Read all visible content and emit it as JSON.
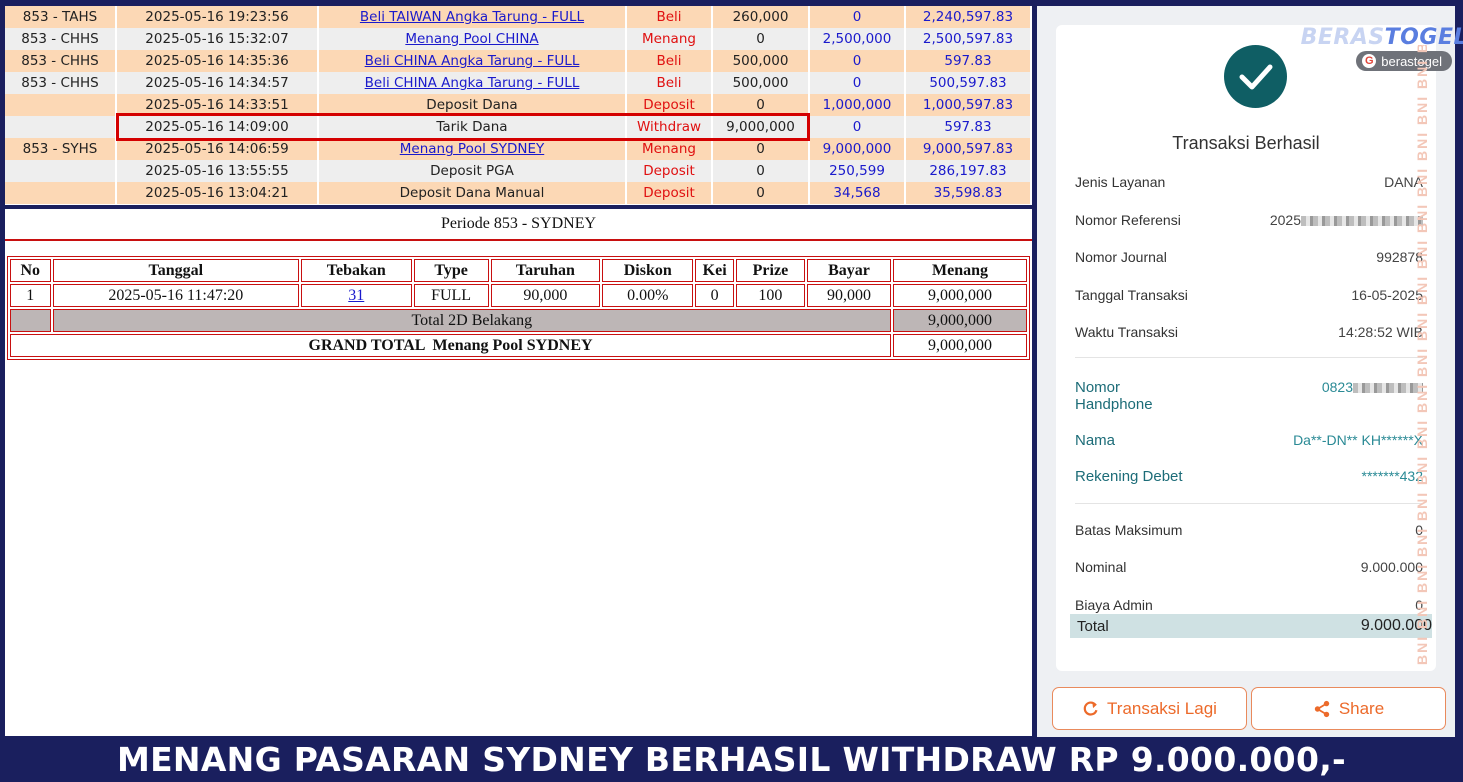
{
  "history": {
    "rows": [
      {
        "code": "853 - TAHS",
        "datetime": "2025-05-16 19:23:56",
        "desc": "Beli TAIWAN Angka Tarung - FULL",
        "is_link": true,
        "type": "Beli",
        "debit": "260,000",
        "credit": "0",
        "balance": "2,240,597.83",
        "tone": "orange"
      },
      {
        "code": "853 - CHHS",
        "datetime": "2025-05-16 15:32:07",
        "desc": "Menang Pool CHINA",
        "is_link": true,
        "type": "Menang",
        "debit": "0",
        "credit": "2,500,000",
        "balance": "2,500,597.83",
        "tone": "grey"
      },
      {
        "code": "853 - CHHS",
        "datetime": "2025-05-16 14:35:36",
        "desc": "Beli CHINA Angka Tarung - FULL",
        "is_link": true,
        "type": "Beli",
        "debit": "500,000",
        "credit": "0",
        "balance": "597.83",
        "tone": "orange"
      },
      {
        "code": "853 - CHHS",
        "datetime": "2025-05-16 14:34:57",
        "desc": "Beli CHINA Angka Tarung - FULL",
        "is_link": true,
        "type": "Beli",
        "debit": "500,000",
        "credit": "0",
        "balance": "500,597.83",
        "tone": "grey"
      },
      {
        "code": "",
        "datetime": "2025-05-16 14:33:51",
        "desc": "Deposit Dana",
        "is_link": false,
        "type": "Deposit",
        "debit": "0",
        "credit": "1,000,000",
        "balance": "1,000,597.83",
        "tone": "orange"
      },
      {
        "code": "",
        "datetime": "2025-05-16 14:09:00",
        "desc": "Tarik Dana",
        "is_link": false,
        "type": "Withdraw",
        "debit": "9,000,000",
        "credit": "0",
        "balance": "597.83",
        "tone": "grey"
      },
      {
        "code": "853 - SYHS",
        "datetime": "2025-05-16 14:06:59",
        "desc": "Menang Pool SYDNEY",
        "is_link": true,
        "type": "Menang",
        "debit": "0",
        "credit": "9,000,000",
        "balance": "9,000,597.83",
        "tone": "orange"
      },
      {
        "code": "",
        "datetime": "2025-05-16 13:55:55",
        "desc": "Deposit PGA",
        "is_link": false,
        "type": "Deposit",
        "debit": "0",
        "credit": "250,599",
        "balance": "286,197.83",
        "tone": "grey"
      },
      {
        "code": "",
        "datetime": "2025-05-16 13:04:21",
        "desc": "Deposit Dana Manual",
        "is_link": false,
        "type": "Deposit",
        "debit": "0",
        "credit": "34,568",
        "balance": "35,598.83",
        "tone": "orange"
      }
    ]
  },
  "period": {
    "title": "Periode 853 - SYDNEY",
    "headers": [
      "No",
      "Tanggal",
      "Tebakan",
      "Type",
      "Taruhan",
      "Diskon",
      "Kei",
      "Prize",
      "Bayar",
      "Menang"
    ],
    "row": {
      "no": "1",
      "tanggal": "2025-05-16 11:47:20",
      "tebakan": "31",
      "type": "FULL",
      "taruhan": "90,000",
      "diskon": "0.00%",
      "kei": "0",
      "prize": "100",
      "bayar": "90,000",
      "menang": "9,000,000"
    },
    "total_label": "Total 2D Belakang",
    "total_value": "9,000,000",
    "grand_label": "GRAND TOTAL  Menang Pool SYDNEY",
    "grand_value": "9,000,000"
  },
  "receipt": {
    "brand_logo_pre": "BERAS",
    "brand_logo": "TOGEL",
    "brand_pill": "berastogel",
    "title": "Transaksi Berhasil",
    "jenis_layanan_label": "Jenis Layanan",
    "jenis_layanan": "DANA",
    "nomor_referensi_label": "Nomor Referensi",
    "nomor_referensi": "2025",
    "nomor_journal_label": "Nomor Journal",
    "nomor_journal": "992878",
    "tanggal_label": "Tanggal Transaksi",
    "tanggal": "16-05-2025",
    "waktu_label": "Waktu Transaksi",
    "waktu": "14:28:52 WIB",
    "nomor_hp_label": "Nomor Handphone",
    "nomor_hp": "0823",
    "nama_label": "Nama",
    "nama": "Da**-DN** KH******X",
    "rekening_label": "Rekening Debet",
    "rekening": "*******432",
    "batas_label": "Batas Maksimum",
    "batas": "0",
    "nominal_label": "Nominal",
    "nominal": "9.000.000",
    "biaya_label": "Biaya Admin",
    "biaya": "0",
    "total_label": "Total",
    "total": "9.000.000",
    "watermark": "BNI BNI BNI BNI BNI BNI BNI BNI BNI BNI BNI BNI BNI BNI BNI BNI BNI BNI",
    "btn_again": "Transaksi Lagi",
    "btn_share": "Share"
  },
  "caption": "MENANG PASARAN SYDNEY BERHASIL WITHDRAW RP 9.000.000,-",
  "colors": {
    "teal": "#0f5e64",
    "accent": "#ec6a2a",
    "red": "#c81010",
    "link": "#1a1acc",
    "bg": "#1a1f5e"
  },
  "icons": [
    "check-icon",
    "refresh-icon",
    "share-icon",
    "google-icon"
  ]
}
